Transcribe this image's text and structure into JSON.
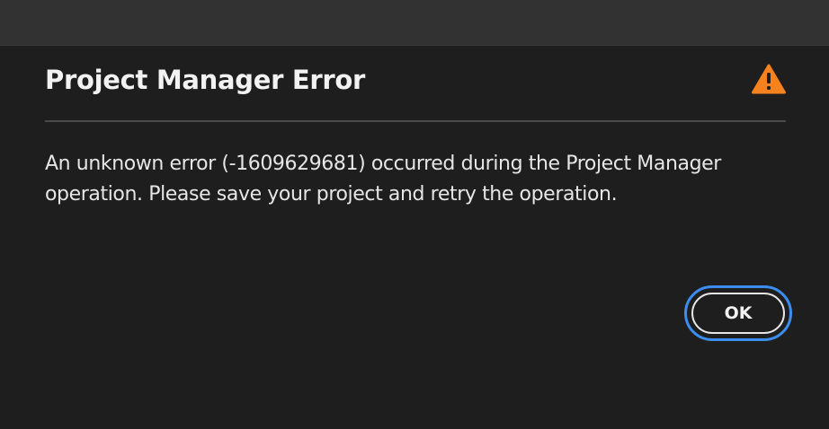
{
  "dialog": {
    "title": "Project Manager Error",
    "icon": "warning-icon",
    "message": "An unknown error (-1609629681) occurred during the Project Manager operation. Please save your project and retry the operation.",
    "ok_label": "OK"
  },
  "colors": {
    "background": "#1e1e1e",
    "titlebar": "#323232",
    "warning": "#f5821f",
    "focus_ring": "#3b8ef0",
    "text": "#f2f2f2"
  }
}
